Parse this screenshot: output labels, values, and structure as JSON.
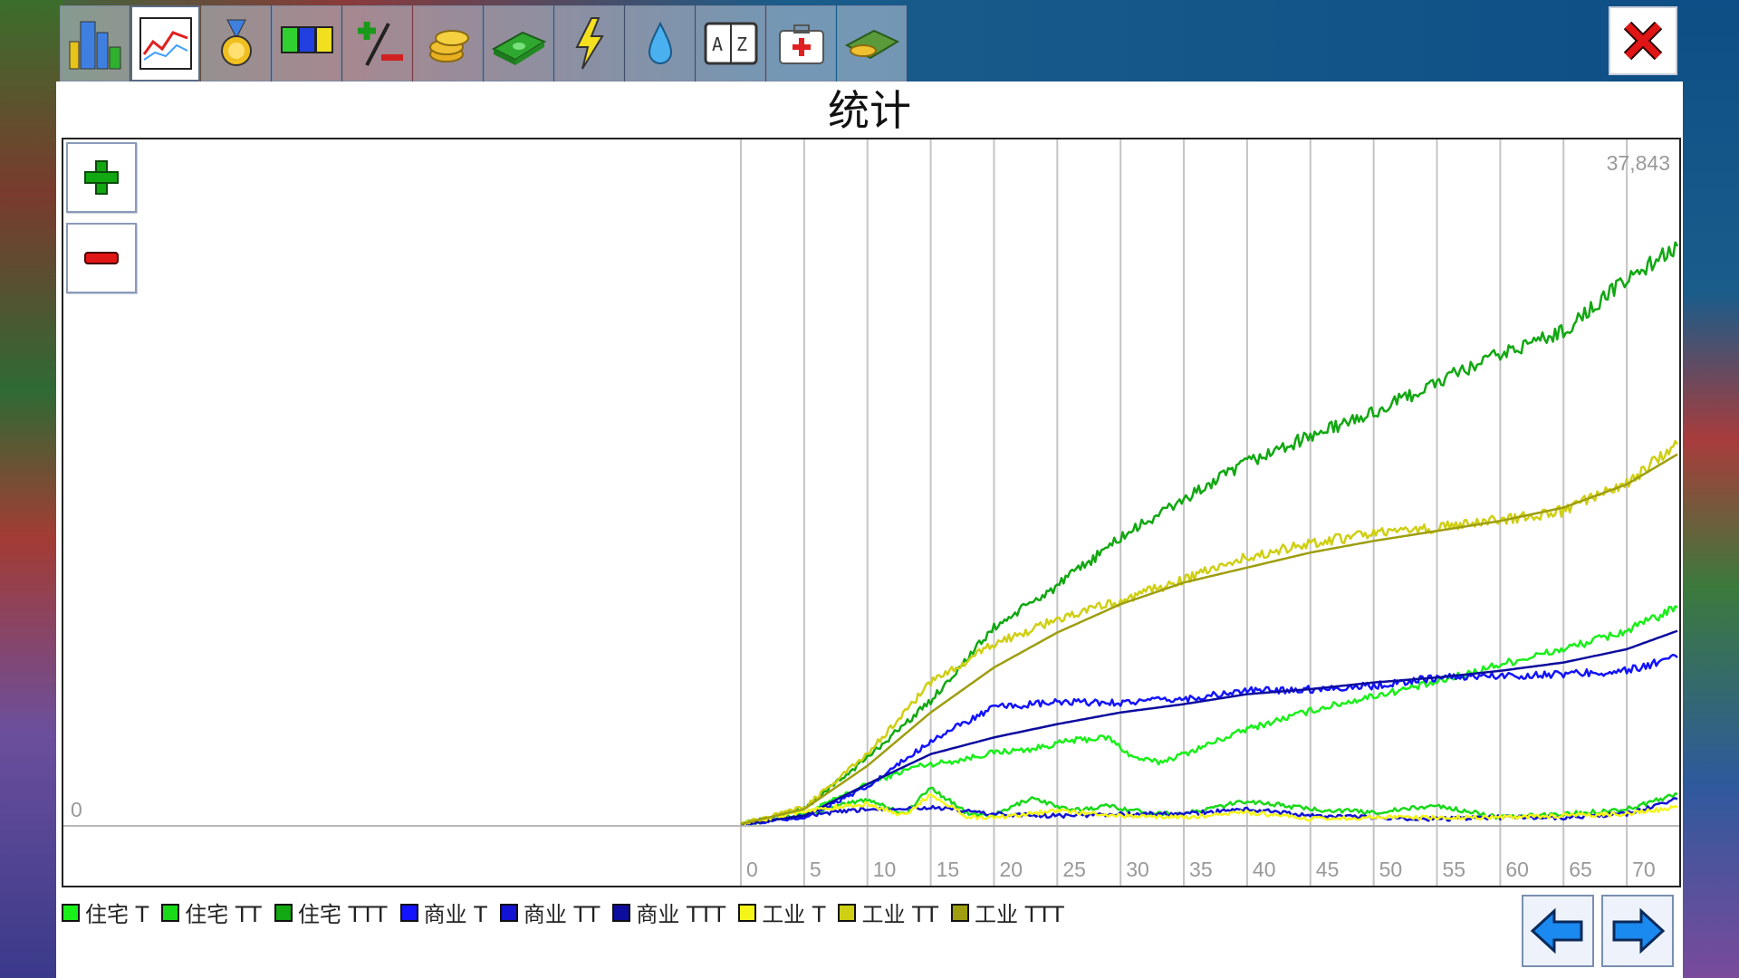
{
  "window": {
    "title": "统计"
  },
  "toolbar": {
    "tabs": [
      {
        "icon": "city-icon"
      },
      {
        "icon": "line-chart-icon",
        "active": true
      },
      {
        "icon": "medal-icon"
      },
      {
        "icon": "zone-colors-icon"
      },
      {
        "icon": "percent-icon"
      },
      {
        "icon": "coins-icon"
      },
      {
        "icon": "money-icon"
      },
      {
        "icon": "lightning-icon"
      },
      {
        "icon": "water-drop-icon"
      },
      {
        "icon": "dictionary-icon"
      },
      {
        "icon": "medkit-icon"
      },
      {
        "icon": "farm-coins-icon"
      }
    ]
  },
  "colors": {
    "res": "#19d919",
    "com": "#1313d3",
    "ind": "#e6e613",
    "res_l": "#19f019",
    "res_m": "#19d919",
    "res_h": "#11a811",
    "com_l": "#1313ff",
    "com_m": "#1313d3",
    "com_h": "#0c0c9e",
    "ind_l": "#f5f51a",
    "ind_m": "#cfcf13",
    "ind_h": "#9e9e10"
  },
  "chart_data": {
    "type": "line",
    "ymax_label": "37,843",
    "ymin_label": "0",
    "ylim": [
      0,
      37843
    ],
    "x_ticks": [
      "0",
      "5",
      "10",
      "15",
      "20",
      "25",
      "30",
      "35",
      "40",
      "45",
      "50",
      "55",
      "60",
      "65",
      "70"
    ],
    "xlim": [
      0,
      74
    ],
    "series": [
      {
        "name": "住宅 T",
        "color": "#19f019",
        "x": [
          0,
          5,
          10,
          14,
          17,
          20,
          23,
          26,
          29,
          31,
          33,
          35,
          40,
          45,
          50,
          55,
          60,
          65,
          70,
          74
        ],
        "y": [
          0,
          600,
          2400,
          3500,
          3800,
          4300,
          4500,
          5000,
          5200,
          4000,
          3700,
          4200,
          5700,
          6800,
          7700,
          8500,
          9600,
          10500,
          11600,
          13000
        ]
      },
      {
        "name": "住宅 TT",
        "color": "#19d919",
        "x": [
          0,
          5,
          10,
          13,
          15,
          18,
          20,
          23,
          26,
          29,
          32,
          35,
          40,
          45,
          50,
          55,
          60,
          65,
          70,
          74
        ],
        "y": [
          0,
          600,
          1500,
          600,
          2200,
          600,
          500,
          1600,
          800,
          1100,
          700,
          600,
          1400,
          900,
          700,
          1100,
          400,
          600,
          900,
          1800
        ]
      },
      {
        "name": "住宅 TTT",
        "color": "#11a811",
        "x": [
          0,
          5,
          10,
          15,
          20,
          25,
          30,
          35,
          40,
          45,
          50,
          55,
          60,
          65,
          70,
          74
        ],
        "y": [
          0,
          900,
          4000,
          7400,
          11800,
          14300,
          17200,
          19500,
          21700,
          23300,
          24700,
          26500,
          28200,
          29600,
          32700,
          34700
        ]
      },
      {
        "name": "商业 T",
        "color": "#1313ff",
        "x": [
          0,
          5,
          10,
          15,
          20,
          25,
          30,
          35,
          40,
          45,
          50,
          55,
          60,
          65,
          70,
          74
        ],
        "y": [
          0,
          400,
          2200,
          5000,
          7000,
          7300,
          7300,
          7500,
          8000,
          8100,
          8300,
          8800,
          8900,
          9000,
          9200,
          10000
        ]
      },
      {
        "name": "商业 TT",
        "color": "#1313d3",
        "x": [
          0,
          5,
          10,
          15,
          20,
          25,
          30,
          35,
          40,
          45,
          50,
          55,
          60,
          65,
          70,
          74
        ],
        "y": [
          0,
          500,
          900,
          1000,
          600,
          500,
          600,
          600,
          900,
          500,
          400,
          300,
          400,
          400,
          600,
          1500
        ]
      },
      {
        "name": "商业 TTT",
        "color": "#0c0c9e",
        "x": [
          0,
          5,
          10,
          15,
          20,
          25,
          30,
          35,
          40,
          45,
          50,
          55,
          60,
          65,
          70,
          74
        ],
        "y": [
          0,
          500,
          2400,
          4200,
          5200,
          6000,
          6700,
          7200,
          7800,
          8100,
          8500,
          8800,
          9200,
          9700,
          10500,
          11600
        ]
      },
      {
        "name": "工业 T",
        "color": "#f5f51a",
        "x": [
          0,
          5,
          10,
          13,
          15,
          18,
          20,
          25,
          30,
          35,
          40,
          45,
          50,
          55,
          60,
          65,
          70,
          74
        ],
        "y": [
          0,
          800,
          1200,
          500,
          1800,
          400,
          400,
          800,
          500,
          400,
          700,
          300,
          400,
          400,
          400,
          500,
          600,
          1000
        ]
      },
      {
        "name": "工业 TT",
        "color": "#cfcf13",
        "x": [
          0,
          5,
          10,
          15,
          20,
          25,
          30,
          35,
          40,
          45,
          50,
          55,
          60,
          65,
          70,
          74
        ],
        "y": [
          0,
          1000,
          4200,
          8500,
          10800,
          12300,
          13400,
          14700,
          16000,
          16900,
          17400,
          17800,
          18300,
          18800,
          20500,
          22800
        ]
      },
      {
        "name": "工业 TTT",
        "color": "#9e9e10",
        "x": [
          0,
          5,
          10,
          15,
          20,
          25,
          30,
          35,
          40,
          45,
          50,
          55,
          60,
          65,
          70,
          74
        ],
        "y": [
          0,
          900,
          3500,
          6700,
          9400,
          11500,
          13200,
          14500,
          15400,
          16300,
          17000,
          17600,
          18200,
          19000,
          20400,
          22200
        ]
      }
    ]
  },
  "legend": {
    "items": [
      {
        "label": "住宅 T",
        "color": "#19f019"
      },
      {
        "label": "住宅 TT",
        "color": "#19d919"
      },
      {
        "label": "住宅 TTT",
        "color": "#11a811"
      },
      {
        "label": "商业 T",
        "color": "#1313ff"
      },
      {
        "label": "商业 TT",
        "color": "#1313d3"
      },
      {
        "label": "商业 TTT",
        "color": "#0c0c9e"
      },
      {
        "label": "工业 T",
        "color": "#f5f51a"
      },
      {
        "label": "工业 TT",
        "color": "#cfcf13"
      },
      {
        "label": "工业 TTT",
        "color": "#9e9e10"
      }
    ]
  }
}
